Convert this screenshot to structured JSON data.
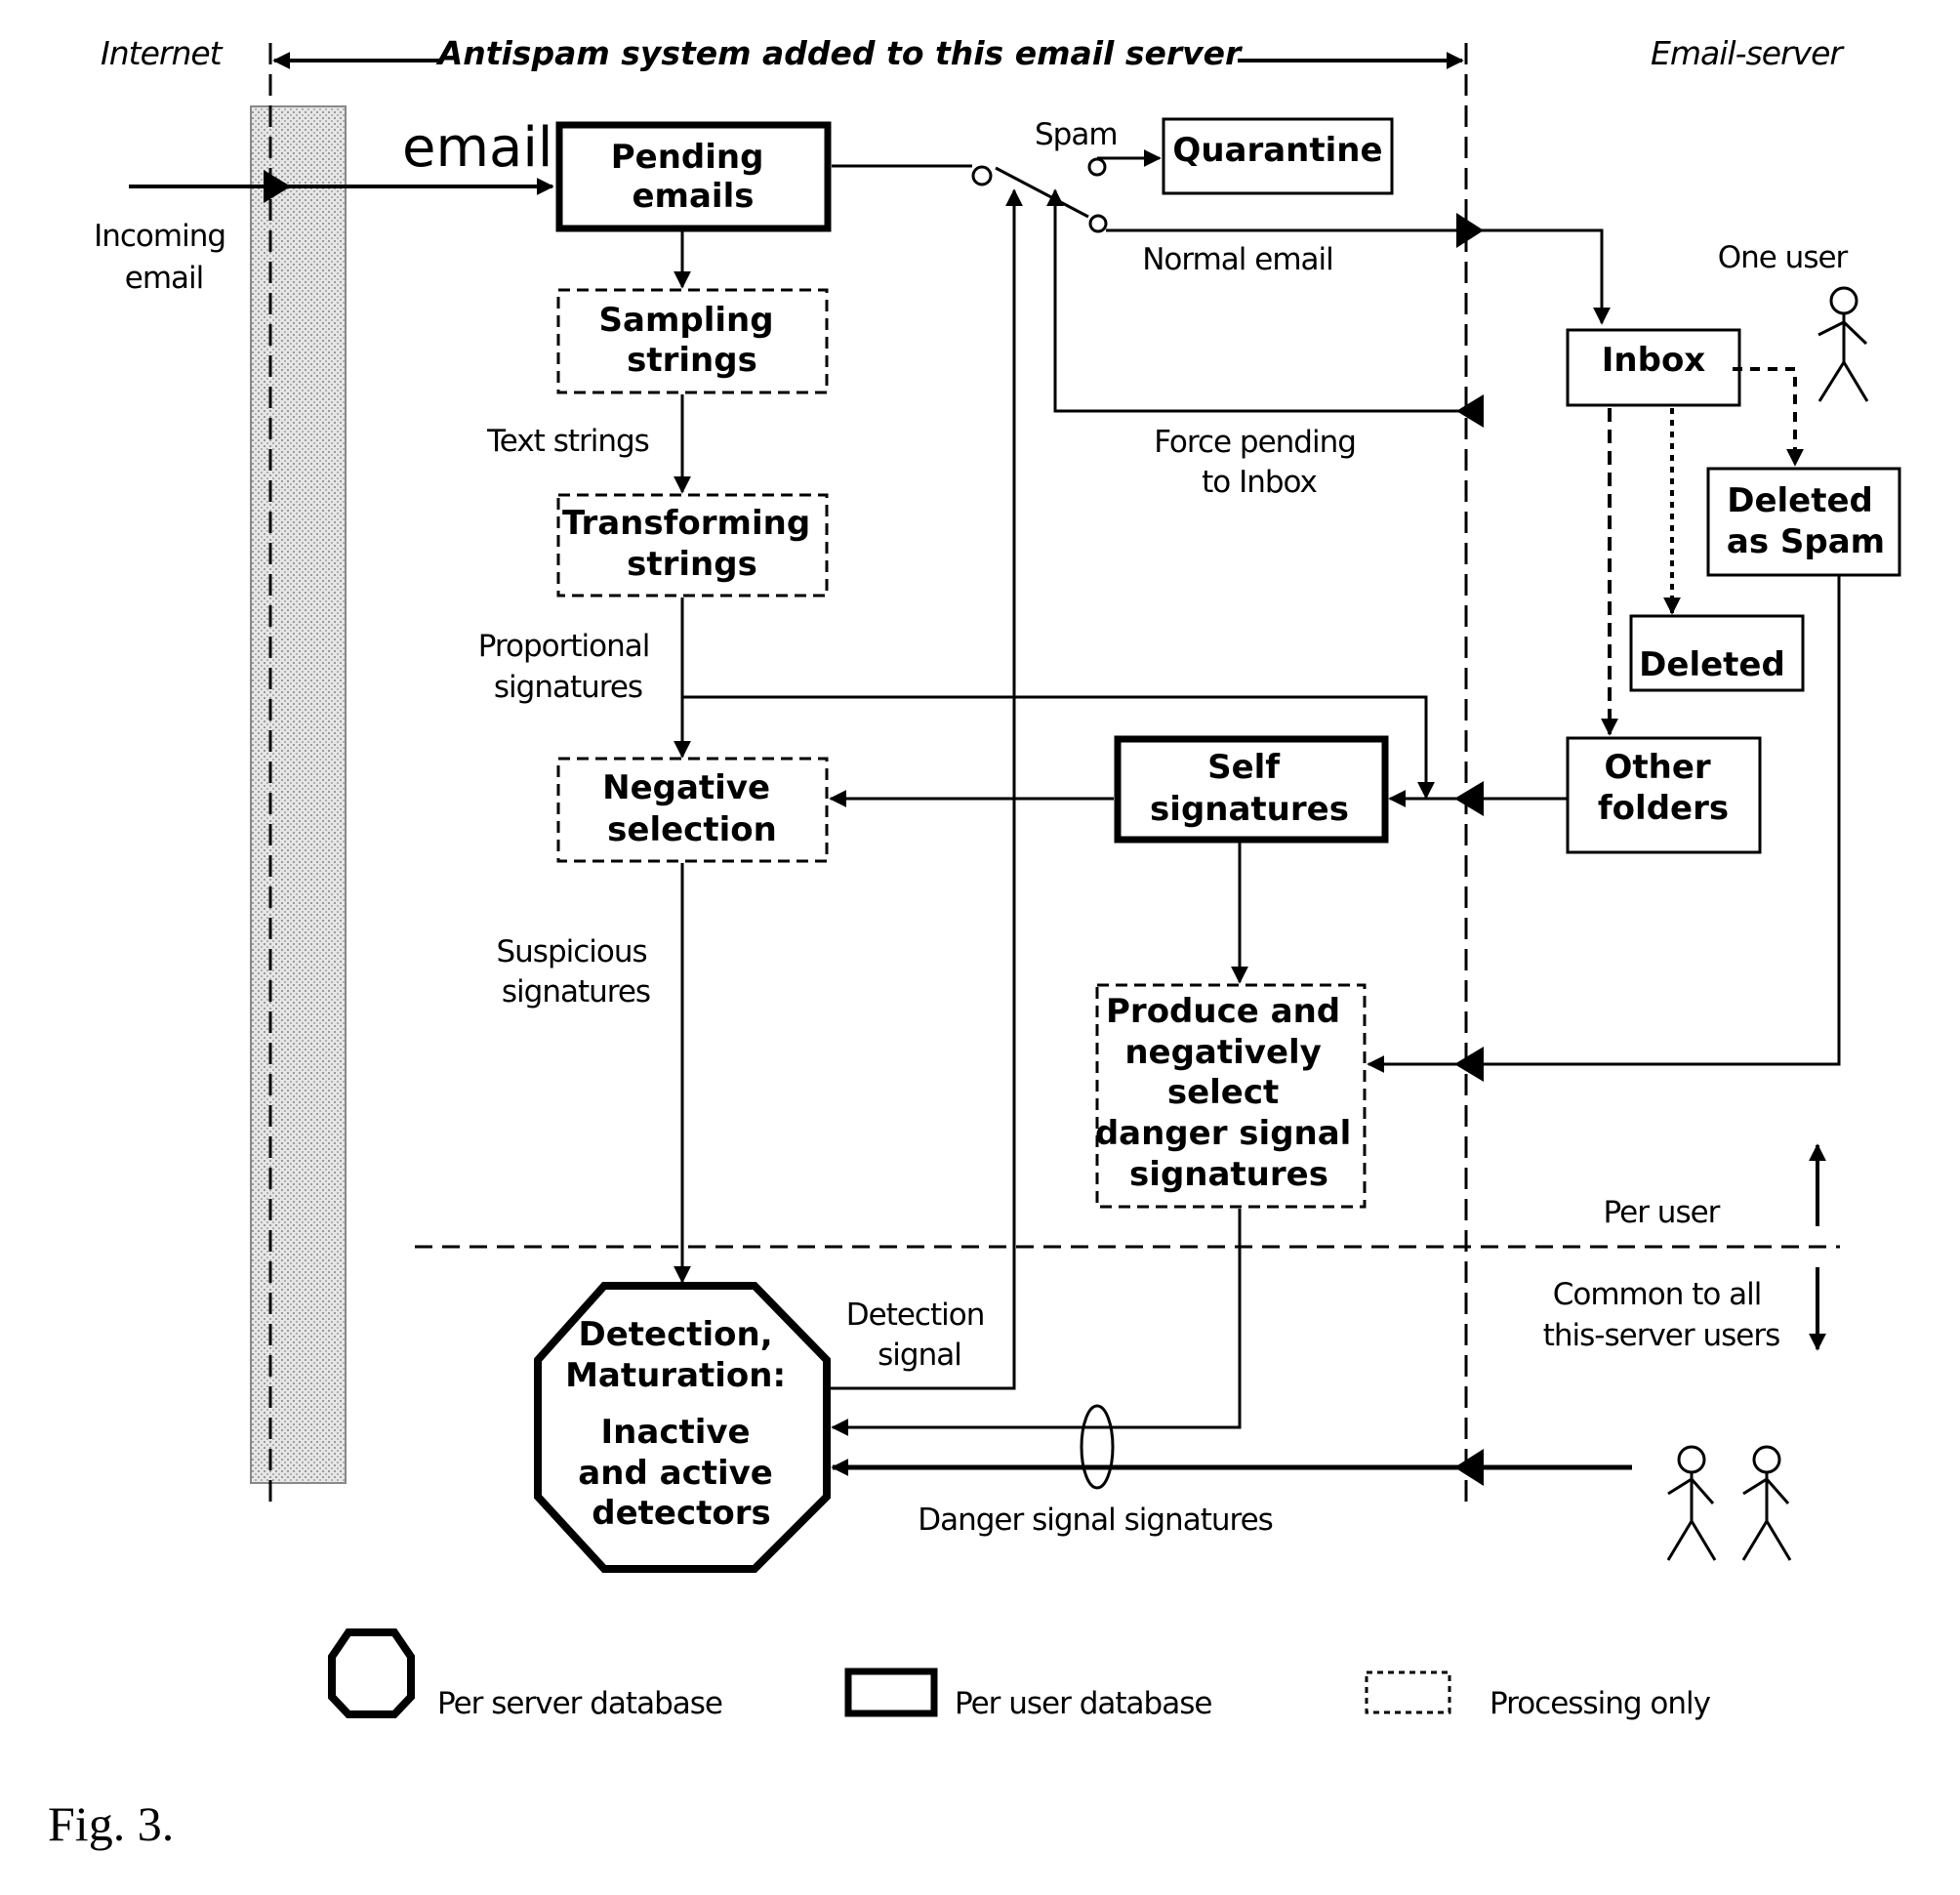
{
  "header": {
    "internet_label": "Internet",
    "antispam_label": "Antispam system added to this email server",
    "email_server_label": "Email-server"
  },
  "inputs": {
    "email_label": "email",
    "incoming_email": [
      "Incoming",
      "email"
    ]
  },
  "boxes": {
    "pending": [
      "Pending",
      "emails"
    ],
    "quarantine": [
      "Quarantine"
    ],
    "sampling": [
      "Sampling",
      "strings"
    ],
    "transforming": [
      "Transforming",
      "strings"
    ],
    "negative": [
      "Negative",
      "selection"
    ],
    "self_signatures": [
      "Self",
      "signatures"
    ],
    "produce": [
      "Produce and",
      "negatively",
      "select",
      "danger signal",
      "signatures"
    ],
    "inbox": [
      "Inbox"
    ],
    "deleted_as_spam": [
      "Deleted",
      "as Spam"
    ],
    "deleted": [
      "Deleted"
    ],
    "other_folders": [
      "Other",
      "folders"
    ],
    "detectors": [
      "Detection,",
      "Maturation:",
      "",
      "Inactive",
      "and active",
      "detectors"
    ]
  },
  "edge_labels": {
    "spam": "Spam",
    "normal_email": "Normal email",
    "force_pending": [
      "Force pending",
      "to Inbox"
    ],
    "text_strings": "Text strings",
    "proportional_signatures": [
      "Proportional",
      "signatures"
    ],
    "suspicious_signatures": [
      "Suspicious",
      "signatures"
    ],
    "detection_signal": [
      "Detection",
      "signal"
    ],
    "danger_signal_signatures": "Danger signal signatures",
    "one_user": "One user",
    "per_user": "Per user",
    "common_to_all": [
      "Common to all",
      "this-server users"
    ]
  },
  "legend": {
    "per_server": "Per server database",
    "per_user": "Per user database",
    "processing": "Processing only"
  },
  "caption": "Fig. 3."
}
